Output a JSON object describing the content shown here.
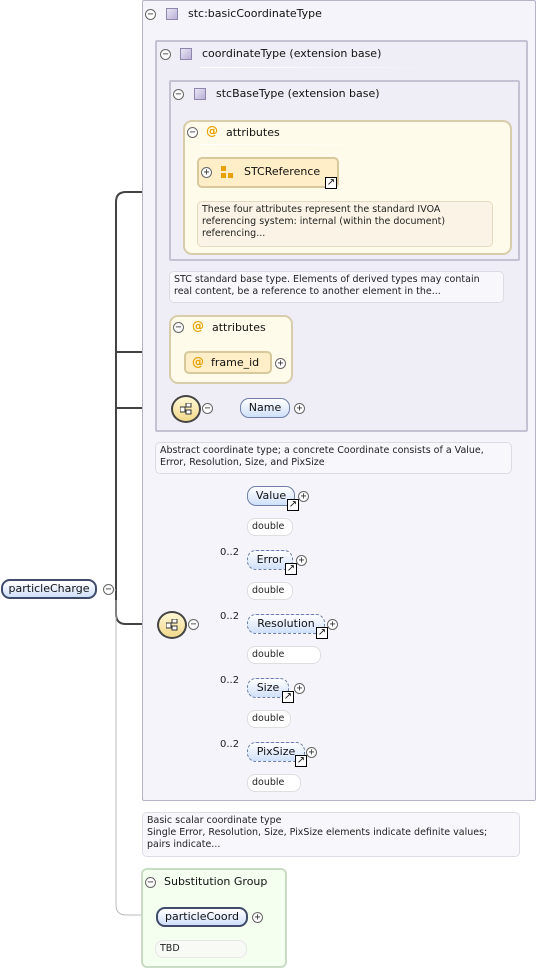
{
  "root": {
    "label": "particleCharge"
  },
  "type": {
    "title": "stc:basicCoordinateType",
    "doc": "Basic scalar coordinate type\nSingle Error, Resolution, Size, PixSize elements indicate definite values;\npairs indicate...",
    "ext1": {
      "title": "coordinateType (extension base)",
      "doc": "Abstract coordinate type; a concrete Coordinate consists of a Value,\nError, Resolution, Size, and PixSize",
      "ext2": {
        "title": "stcBaseType (extension base)",
        "doc": "STC standard base type. Elements of derived types may contain\nreal content, be a reference to another element in the...",
        "attributes": {
          "title": "attributes",
          "group": "STCReference",
          "doc": "These four attributes represent the standard IVOA\nreferencing system: internal (within the document)\nreferencing..."
        }
      },
      "attributes": {
        "title": "attributes",
        "attr": "frame_id"
      },
      "name_element": "Name"
    },
    "sequence": [
      {
        "label": "Value",
        "card": "",
        "type": "double"
      },
      {
        "label": "Error",
        "card": "0..2",
        "type": "double"
      },
      {
        "label": "Resolution",
        "card": "0..2",
        "type": "double"
      },
      {
        "label": "Size",
        "card": "0..2",
        "type": "double"
      },
      {
        "label": "PixSize",
        "card": "0..2",
        "type": "double"
      }
    ]
  },
  "substitution": {
    "title": "Substitution Group",
    "element": "particleCoord",
    "doc": "TBD"
  },
  "icons": {
    "collapse": "minus-circle-icon",
    "expand": "plus-circle-icon",
    "complex_type": "complex-type-icon",
    "attribute": "attribute-icon",
    "attribute_group": "attribute-group-icon",
    "sequence": "sequence-compositor-icon",
    "reference": "reference-arrow-icon"
  }
}
